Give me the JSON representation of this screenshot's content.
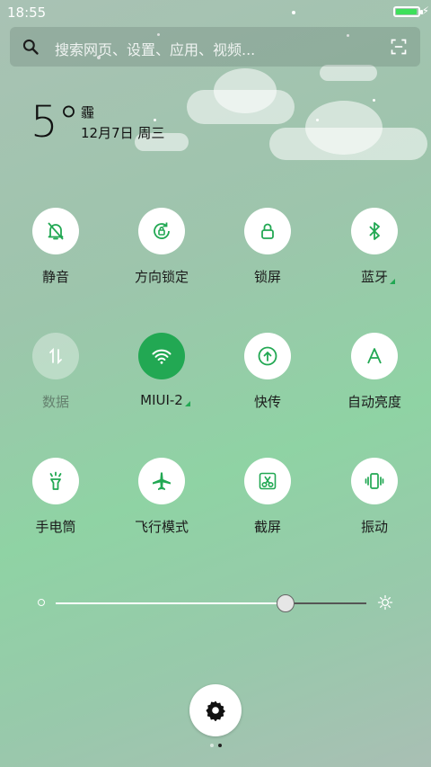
{
  "status_bar": {
    "time": "18:55",
    "battery_level": 0.95
  },
  "search": {
    "placeholder": "搜索网页、设置、应用、视频..."
  },
  "weather": {
    "temperature": "5°",
    "condition": "霾",
    "date": "12月7日 周三"
  },
  "toggles": [
    {
      "id": "mute",
      "label": "静音",
      "icon": "bell-off-icon",
      "state": "inactive"
    },
    {
      "id": "rotation-lock",
      "label": "方向锁定",
      "icon": "rotation-lock-icon",
      "state": "inactive"
    },
    {
      "id": "lock-screen",
      "label": "锁屏",
      "icon": "lock-icon",
      "state": "inactive"
    },
    {
      "id": "bluetooth",
      "label": "蓝牙",
      "icon": "bluetooth-icon",
      "state": "inactive",
      "has_more": true
    },
    {
      "id": "mobile-data",
      "label": "数据",
      "icon": "data-arrows-icon",
      "state": "disabled"
    },
    {
      "id": "wifi",
      "label": "MIUI-2",
      "icon": "wifi-icon",
      "state": "active",
      "has_more": true
    },
    {
      "id": "quick-transfer",
      "label": "快传",
      "icon": "upload-icon",
      "state": "inactive"
    },
    {
      "id": "auto-brightness",
      "label": "自动亮度",
      "icon": "letter-a-icon",
      "state": "inactive"
    },
    {
      "id": "flashlight",
      "label": "手电筒",
      "icon": "flashlight-icon",
      "state": "inactive"
    },
    {
      "id": "airplane-mode",
      "label": "飞行模式",
      "icon": "airplane-icon",
      "state": "inactive"
    },
    {
      "id": "screenshot",
      "label": "截屏",
      "icon": "scissors-icon",
      "state": "inactive"
    },
    {
      "id": "vibrate",
      "label": "振动",
      "icon": "vibrate-icon",
      "state": "inactive"
    }
  ],
  "brightness": {
    "level": 0.74
  },
  "page_indicator": {
    "count": 2,
    "current": 2
  },
  "colors": {
    "accent": "#22a853"
  }
}
